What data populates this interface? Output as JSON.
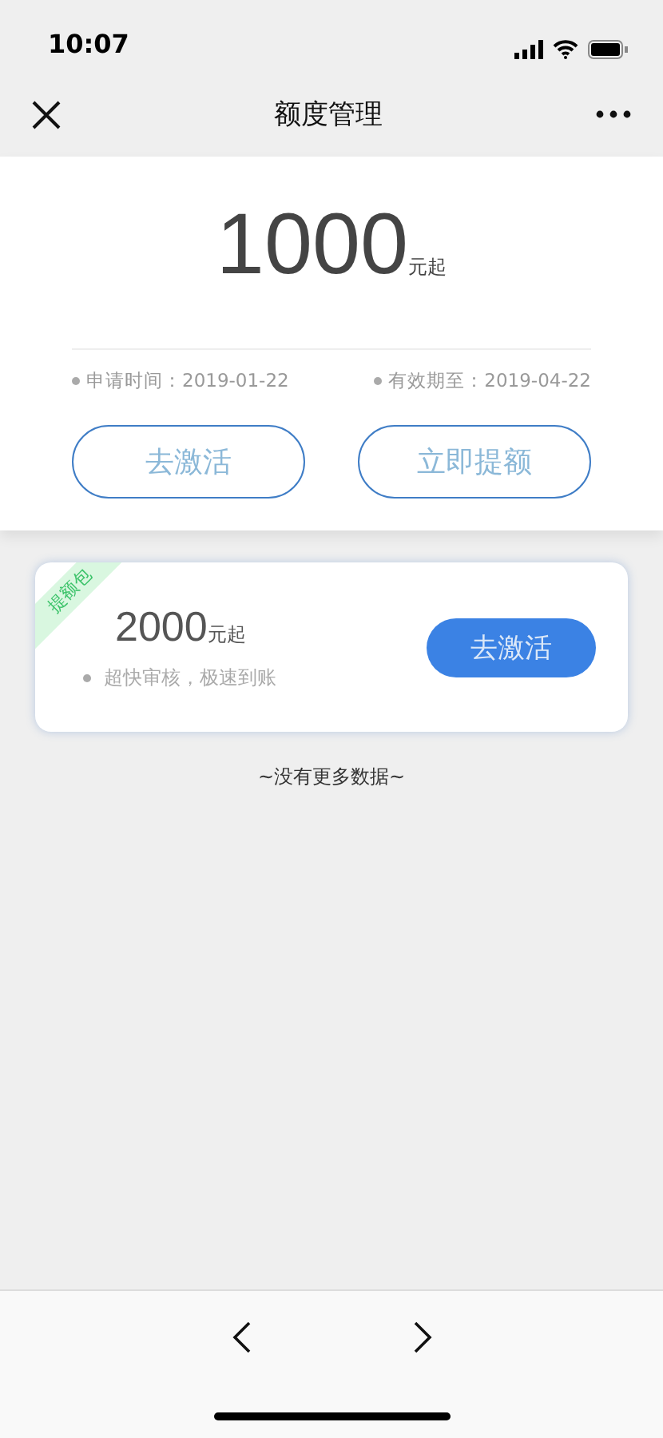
{
  "status_bar": {
    "time": "10:07"
  },
  "nav": {
    "title": "额度管理"
  },
  "quota": {
    "amount": "1000",
    "unit": "元起",
    "details": [
      {
        "label": "申请时间：2019-01-22"
      },
      {
        "label": "有效期至：2019-04-22"
      }
    ],
    "buttons": [
      "去激活",
      "立即提额"
    ]
  },
  "packages": [
    {
      "tag": "提额包",
      "amount": "2000",
      "unit": "元起",
      "note": "超快审核，极速到账",
      "button": "去激活"
    }
  ],
  "end_text": "~没有更多数据~",
  "toolbar": {
    "back_enabled": true,
    "forward_enabled": true
  }
}
